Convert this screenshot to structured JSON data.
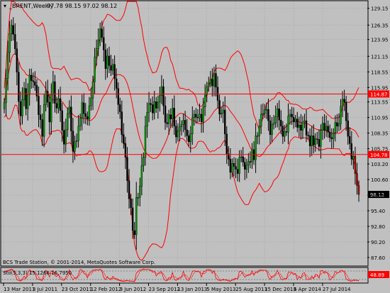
{
  "header": {
    "symbol_label": "_BRENT,Weekly",
    "ohlc_label": "97.78 98.15 97.02 98.12"
  },
  "copyright": "BCS Trade Station, © 2001-2014, MetaQuotes Software Corp.",
  "oscillator": {
    "label": "Sto(5,3,3) 15.1266 16.7950",
    "levels": [
      80,
      20
    ],
    "current_label": "48.89"
  },
  "colors": {
    "background": "#c0c0c0",
    "grid": "#a9a9a9",
    "bull_candle": "#00a000",
    "bear_candle": "#000000",
    "bollinger": "#ff0000",
    "horizontal_lines": "#ff0000",
    "price_tag_bg": "#000000",
    "hline_tag_bg": "#ff0000"
  },
  "chart_data": {
    "type": "candlestick",
    "timeframe": "Weekly",
    "y_ticks": [
      "129.15",
      "126.35",
      "123.95",
      "121.15",
      "118.55",
      "115.95",
      "113.55",
      "110.95",
      "108.35",
      "105.75",
      "103.20",
      "100.60",
      "98.00",
      "95.40",
      "92.80",
      "90.20",
      "87.60"
    ],
    "x_ticks": [
      "13 Mar 2011",
      "3 Jul 2011",
      "23 Oct 2011",
      "12 Feb 2012",
      "3 Jun 2012",
      "23 Sep 2012",
      "13 Jan 2013",
      "5 May 2013",
      "25 Aug 2013",
      "15 Dec 2013",
      "6 Apr 2014",
      "27 Jul 2014"
    ],
    "ylim": [
      86.3,
      130.3
    ],
    "current_price": 98.12,
    "current_price_label": "98.12",
    "horizontal_lines": [
      {
        "value": 114.87,
        "label": "114.87"
      },
      {
        "value": 104.78,
        "label": "104.78"
      }
    ],
    "bollinger_bands": true,
    "grid": true,
    "closes": [
      113.4,
      117.5,
      121.8,
      124.9,
      126.3,
      124.8,
      122.4,
      118.5,
      113.6,
      111.2,
      113.9,
      115.8,
      112.4,
      114.8,
      118.0,
      117.1,
      116.9,
      116.3,
      114.5,
      111.4,
      110.6,
      107.8,
      113.1,
      115.3,
      113.5,
      110.2,
      114.8,
      116.9,
      113.3,
      112.5,
      114.1,
      112.1,
      108.8,
      106.5,
      108.9,
      111.6,
      112.7,
      108.7,
      105.3,
      106.9,
      107.1,
      109.5,
      110.8,
      113.4,
      111.6,
      111.1,
      110.7,
      112.9,
      114.2,
      116.9,
      121.0,
      122.4,
      123.9,
      125.7,
      124.3,
      122.2,
      119.1,
      121.2,
      119.6,
      118.8,
      119.8,
      117.4,
      115.8,
      113.1,
      111.9,
      108.1,
      106.6,
      104.3,
      100.4,
      97.4,
      95.9,
      92.1,
      91.4,
      97.6,
      97.6,
      99.5,
      102.9,
      104.3,
      109.5,
      111.8,
      113.3,
      113.1,
      111.7,
      113.6,
      112.5,
      113.5,
      114.6,
      116.1,
      112.9,
      110.1,
      109.9,
      111.4,
      110.7,
      112.5,
      109.5,
      107.7,
      108.7,
      109.4,
      109.8,
      110.5,
      108.9,
      107.9,
      106.9,
      108.2,
      110.9,
      111.5,
      111.0,
      110.9,
      111.5,
      110.2,
      112.7,
      114.7,
      116.1,
      116.7,
      117.3,
      116.2,
      118.3,
      116.0,
      113.8,
      111.5,
      111.7,
      112.2,
      108.2,
      104.9,
      104.0,
      101.8,
      103.3,
      102.8,
      102.3,
      101.6,
      104.3,
      104.4,
      103.5,
      102.3,
      103.0,
      103.6,
      103.5,
      105.6,
      103.9,
      107.9,
      107.9,
      109.5,
      111.5,
      111.6,
      112.3,
      112.3,
      110.4,
      108.1,
      109.8,
      110.0,
      111.1,
      112.4,
      110.5,
      109.5,
      107.8,
      108.6,
      108.5,
      111.2,
      111.5,
      111.0,
      110.2,
      110.7,
      109.3,
      109.7,
      108.8,
      110.2,
      110.4,
      108.0,
      107.9,
      106.2,
      107.9,
      106.4,
      107.4,
      107.3,
      106.1,
      108.8,
      110.0,
      108.8,
      109.5,
      108.5,
      107.6,
      107.4,
      108.4,
      110.1,
      109.5,
      109.9,
      112.8,
      114.0,
      113.5,
      110.4,
      107.8,
      106.6,
      104.0,
      104.5,
      101.6,
      99.6,
      98.12
    ]
  }
}
